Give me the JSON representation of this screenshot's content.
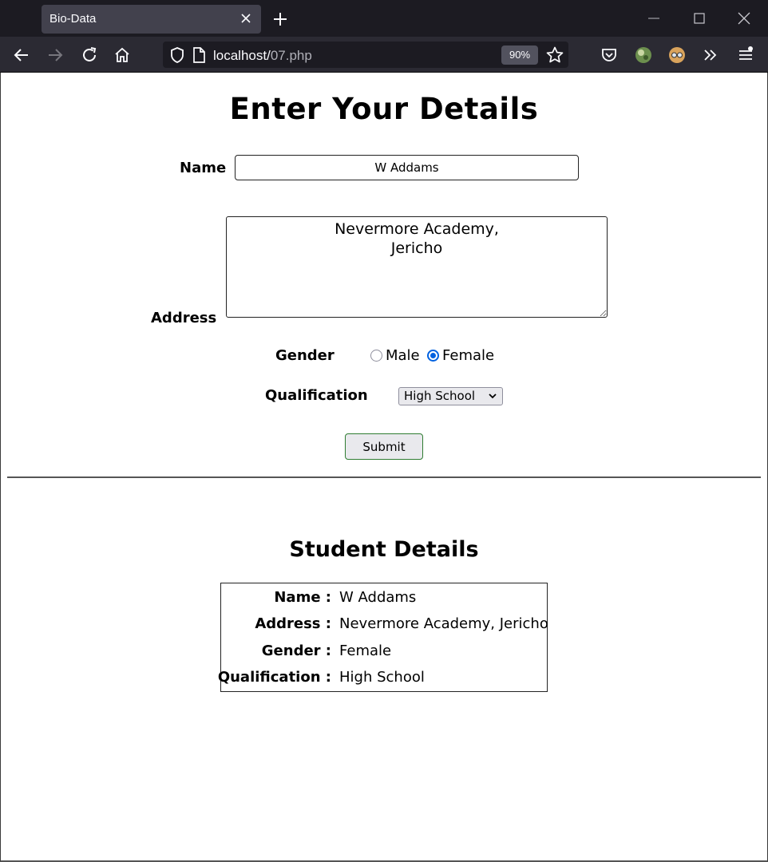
{
  "browser": {
    "tab_title": "Bio-Data",
    "url_host": "localhost/",
    "url_path": "07.php",
    "zoom": "90%"
  },
  "form": {
    "title": "Enter Your Details",
    "name_label": "Name",
    "name_value": "W Addams",
    "address_label": "Address",
    "address_value": "Nevermore Academy,\nJericho",
    "gender_label": "Gender",
    "gender_options": [
      {
        "label": "Male",
        "checked": false
      },
      {
        "label": "Female",
        "checked": true
      }
    ],
    "qualification_label": "Qualification",
    "qualification_selected": "High School",
    "submit_label": "Submit"
  },
  "details": {
    "title": "Student Details",
    "rows": [
      {
        "key": "Name :",
        "value": "W Addams"
      },
      {
        "key": "Address :",
        "value": "Nevermore Academy, Jericho"
      },
      {
        "key": "Gender :",
        "value": "Female"
      },
      {
        "key": "Qualification :",
        "value": "High School"
      }
    ]
  },
  "colors": {
    "chrome_dark": "#1c1b22",
    "toolbar": "#2b2a33",
    "radio_accent": "#0061e0",
    "submit_border": "#2f7d32"
  }
}
